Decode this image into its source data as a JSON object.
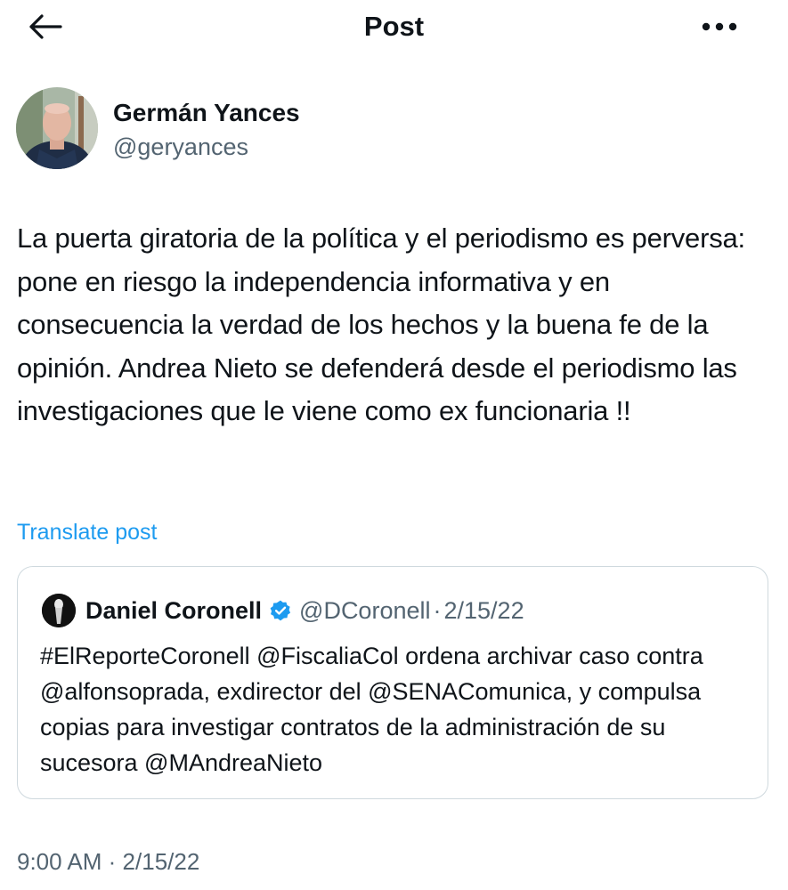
{
  "header": {
    "title": "Post",
    "back_icon": "arrow-left-icon",
    "more_icon": "more-horizontal-icon"
  },
  "author": {
    "name": "Germán Yances",
    "handle": "@geryances",
    "avatar_icon": "profile-photo"
  },
  "tweet": {
    "text": "La puerta giratoria de la política y el periodismo es perversa: pone en riesgo la independencia informativa y en consecuencia la verdad de los hechos y la buena fe de la opinión. Andrea Nieto se defenderá desde el periodismo las investigaciones que le viene como ex funcionaria !!",
    "translate_label": "Translate post",
    "time": "9:00 AM",
    "separator": "·",
    "date": "2/15/22"
  },
  "quoted": {
    "name": "Daniel Coronell",
    "verified_icon": "verified-badge-icon",
    "handle": "@DCoronell",
    "separator": "·",
    "date": "2/15/22",
    "text": "#ElReporteCoronell @FiscaliaCol ordena archivar caso contra @alfonsoprada, exdirector del @SENAComunica, y compulsa copias para investigar contratos de la administración de su sucesora @MAndreaNieto"
  },
  "colors": {
    "text": "#0f1419",
    "secondary": "#536471",
    "link": "#1d9bf0",
    "border": "#cfd9de"
  }
}
